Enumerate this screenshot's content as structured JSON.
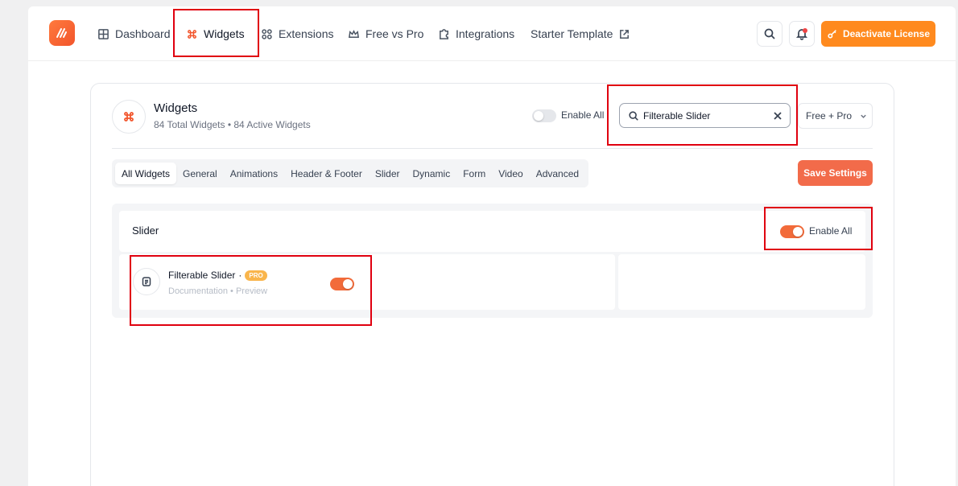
{
  "nav": {
    "items": [
      {
        "label": "Dashboard",
        "icon": "grid-icon"
      },
      {
        "label": "Widgets",
        "icon": "command-icon",
        "active": true
      },
      {
        "label": "Extensions",
        "icon": "extensions-icon"
      },
      {
        "label": "Free vs Pro",
        "icon": "crown-icon"
      },
      {
        "label": "Integrations",
        "icon": "puzzle-icon"
      },
      {
        "label": "Starter Template",
        "icon": "external-link-icon"
      }
    ],
    "license_label": "Deactivate License"
  },
  "header": {
    "title": "Widgets",
    "subtitle": "84 Total Widgets • 84 Active Widgets",
    "enable_all_label": "Enable All",
    "enable_all_on": false,
    "search_value": "Filterable Slider",
    "filter_value": "Free + Pro",
    "save_label": "Save Settings"
  },
  "tabs": [
    "All Widgets",
    "General",
    "Animations",
    "Header & Footer",
    "Slider",
    "Dynamic",
    "Form",
    "Video",
    "Advanced"
  ],
  "section": {
    "title": "Slider",
    "enable_all_label": "Enable All",
    "enable_all_on": true,
    "widgets": [
      {
        "name": "Filterable Slider",
        "separator": "·",
        "badge": "PRO",
        "links": "Documentation • Preview",
        "enabled": true
      }
    ]
  },
  "colors": {
    "accent": "#f26b3a",
    "license": "#ff8a1e",
    "highlight": "#e0000f"
  }
}
